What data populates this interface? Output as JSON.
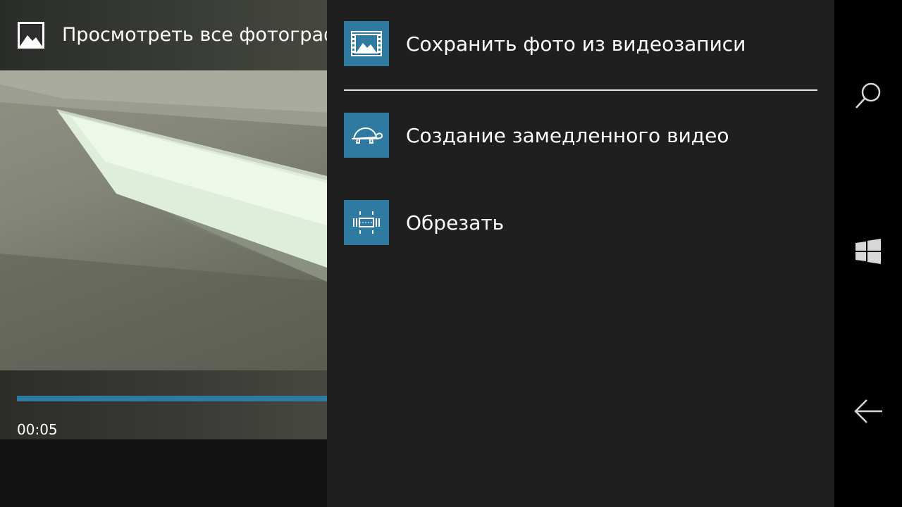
{
  "viewer": {
    "title": "Просмотреть все фотограф",
    "time": "00:05",
    "progress": 1.0
  },
  "menu": {
    "items": [
      {
        "label": "Сохранить фото из видеозаписи",
        "icon": "photo-from-video-icon"
      },
      {
        "label": "Создание замедленного видео",
        "icon": "turtle-icon"
      },
      {
        "label": "Обрезать",
        "icon": "trim-icon"
      }
    ]
  },
  "nav": {
    "buttons": [
      "search-icon",
      "windows-start-icon",
      "back-arrow-icon"
    ]
  },
  "colors": {
    "accent": "#2f7aa0",
    "menu_background": "#1f1f1f",
    "nav_background": "#000000",
    "divider": "#e6e6e6"
  }
}
